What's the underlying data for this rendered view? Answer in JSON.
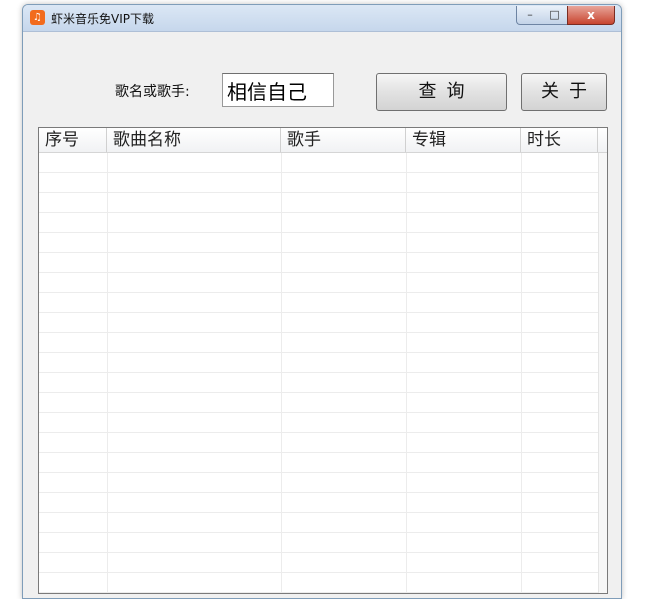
{
  "window": {
    "title": "虾米音乐免VIP下载",
    "controls": {
      "minimize": "–",
      "maximize": "□",
      "close": "x"
    }
  },
  "search": {
    "label": "歌名或歌手:",
    "value": "相信自己"
  },
  "buttons": {
    "query": "查询",
    "about": "关于"
  },
  "table": {
    "columns": [
      "序号",
      "歌曲名称",
      "歌手",
      "专辑",
      "时长"
    ],
    "rows": []
  },
  "colors": {
    "app_icon": "#f26b1d",
    "close_button": "#c8452f"
  }
}
